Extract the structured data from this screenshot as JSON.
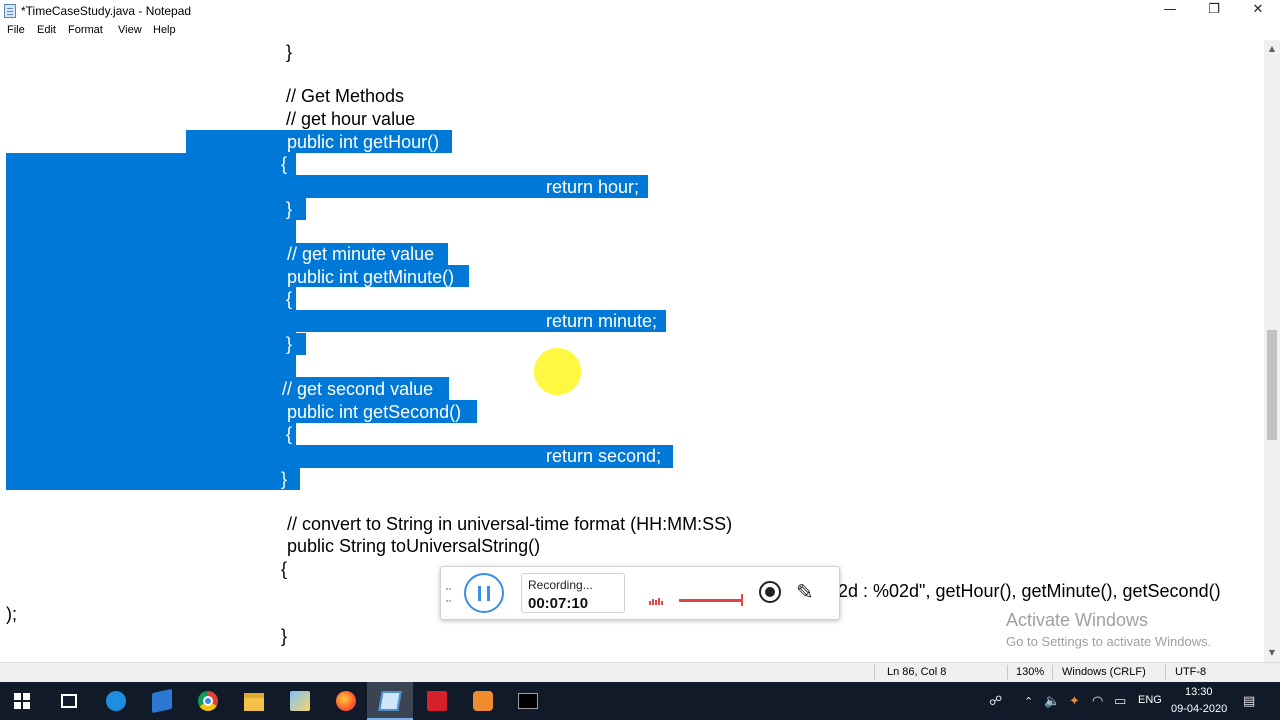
{
  "window": {
    "title": "*TimeCaseStudy.java - Notepad",
    "minimize_glyph": "—",
    "restore_glyph": "❐",
    "close_glyph": "✕"
  },
  "menu": [
    "File",
    "Edit",
    "Format",
    "View",
    "Help"
  ],
  "code_lines": [
    {
      "text": "}",
      "selected": false
    },
    {
      "text": "// Get Methods",
      "selected": false
    },
    {
      "text": "// get hour value",
      "selected": false
    },
    {
      "text": "public int getHour()",
      "selected": true
    },
    {
      "text": "{",
      "selected": true
    },
    {
      "text": "return hour;",
      "selected": true
    },
    {
      "text": "}",
      "selected": true
    },
    {
      "text": "// get minute value",
      "selected": true
    },
    {
      "text": "public int getMinute()",
      "selected": true
    },
    {
      "text": "{",
      "selected": true
    },
    {
      "text": "return minute;",
      "selected": true
    },
    {
      "text": "}",
      "selected": true
    },
    {
      "text": "// get second value",
      "selected": true
    },
    {
      "text": "public int getSecond()",
      "selected": true
    },
    {
      "text": "{",
      "selected": true
    },
    {
      "text": "return second;",
      "selected": true
    },
    {
      "text": "}",
      "selected": true
    },
    {
      "text": "// convert to String in universal-time format (HH:MM:SS)",
      "selected": false
    },
    {
      "text": "public String toUniversalString()",
      "selected": false
    },
    {
      "text": "{",
      "selected": false
    },
    {
      "text": "2d : %02d\", getHour(), getMinute(), getSecond()",
      "selected": false
    },
    {
      "text": ");",
      "selected": false
    },
    {
      "text": "}",
      "selected": false
    }
  ],
  "status": {
    "position": "Ln 86, Col 8",
    "zoom": "130%",
    "line_ending": "Windows (CRLF)",
    "encoding": "UTF-8"
  },
  "watermark": {
    "title": "Activate Windows",
    "subtitle": "Go to Settings to activate Windows."
  },
  "recorder": {
    "status_label": "Recording...",
    "elapsed": "00:07:10",
    "volume_level": 0.85
  },
  "taskbar": {
    "apps": [
      {
        "name": "start-button",
        "icon": "windows-logo-icon"
      },
      {
        "name": "task-view-button",
        "icon": "task-view-icon"
      },
      {
        "name": "edge-button",
        "icon": "edge-icon"
      },
      {
        "name": "store-button",
        "icon": "store-icon"
      },
      {
        "name": "chrome-button",
        "icon": "chrome-icon"
      },
      {
        "name": "file-explorer-button",
        "icon": "folder-icon"
      },
      {
        "name": "photos-button",
        "icon": "photos-icon"
      },
      {
        "name": "firefox-button",
        "icon": "firefox-icon"
      },
      {
        "name": "notepad-button",
        "icon": "notepad-icon",
        "active": true
      },
      {
        "name": "acrobat-button",
        "icon": "pdf-icon"
      },
      {
        "name": "presentation-button",
        "icon": "presentation-icon"
      },
      {
        "name": "terminal-button",
        "icon": "terminal-icon"
      }
    ],
    "language": "ENG",
    "time": "13:30",
    "date": "09-04-2020"
  },
  "colors": {
    "selection": "#0078d7",
    "taskbar": "#101a28",
    "cursor_highlight": "#fff500",
    "recorder_accent": "#3a8ee6"
  }
}
